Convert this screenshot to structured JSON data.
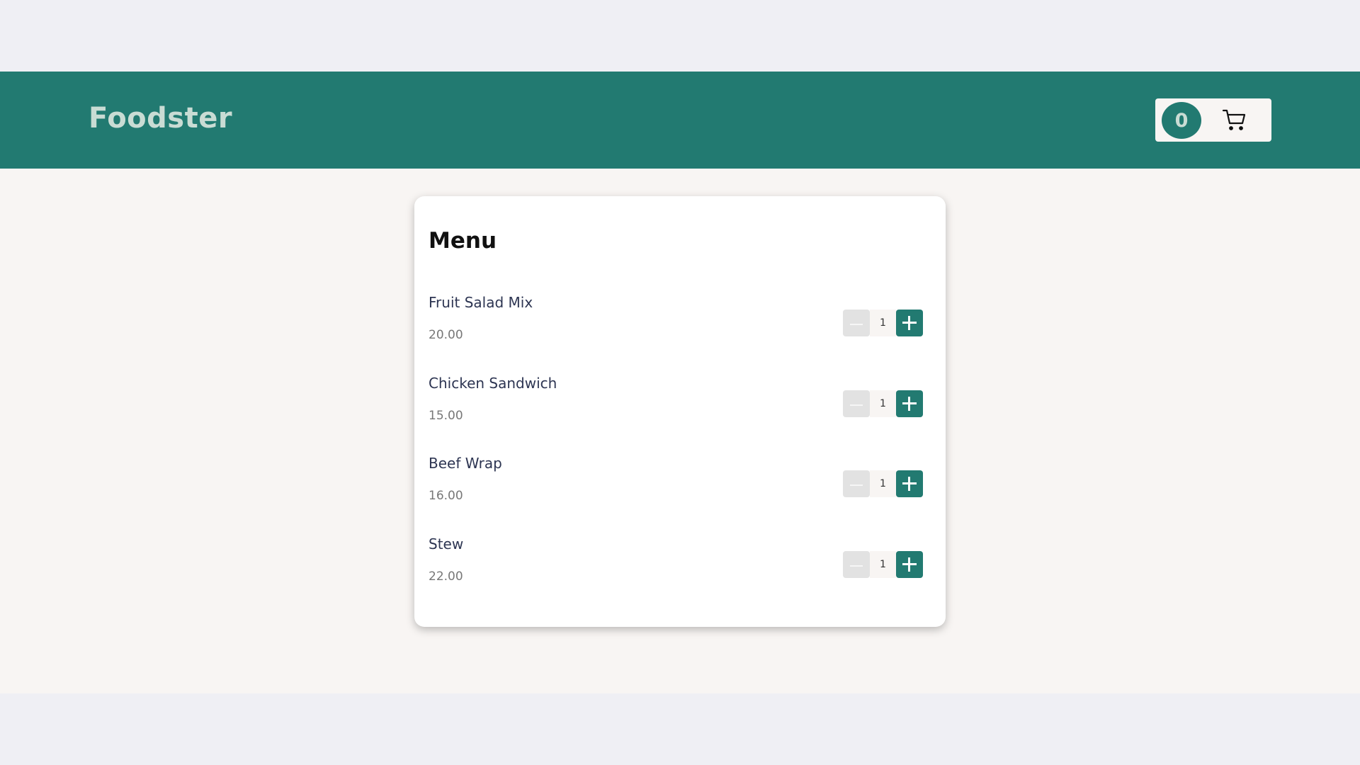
{
  "header": {
    "brand": "Foodster",
    "cart_count": "0",
    "cart_icon": "cart-icon"
  },
  "menu": {
    "title": "Menu",
    "items": [
      {
        "name": "Fruit Salad Mix",
        "price": "20.00",
        "quantity": "1"
      },
      {
        "name": "Chicken Sandwich",
        "price": "15.00",
        "quantity": "1"
      },
      {
        "name": "Beef Wrap",
        "price": "16.00",
        "quantity": "1"
      },
      {
        "name": "Stew",
        "price": "22.00",
        "quantity": "1"
      }
    ]
  },
  "colors": {
    "brand_teal": "#227a71",
    "brand_text": "#c9dcd4",
    "page_background": "#f8f5f3",
    "card_background": "#ffffff"
  }
}
